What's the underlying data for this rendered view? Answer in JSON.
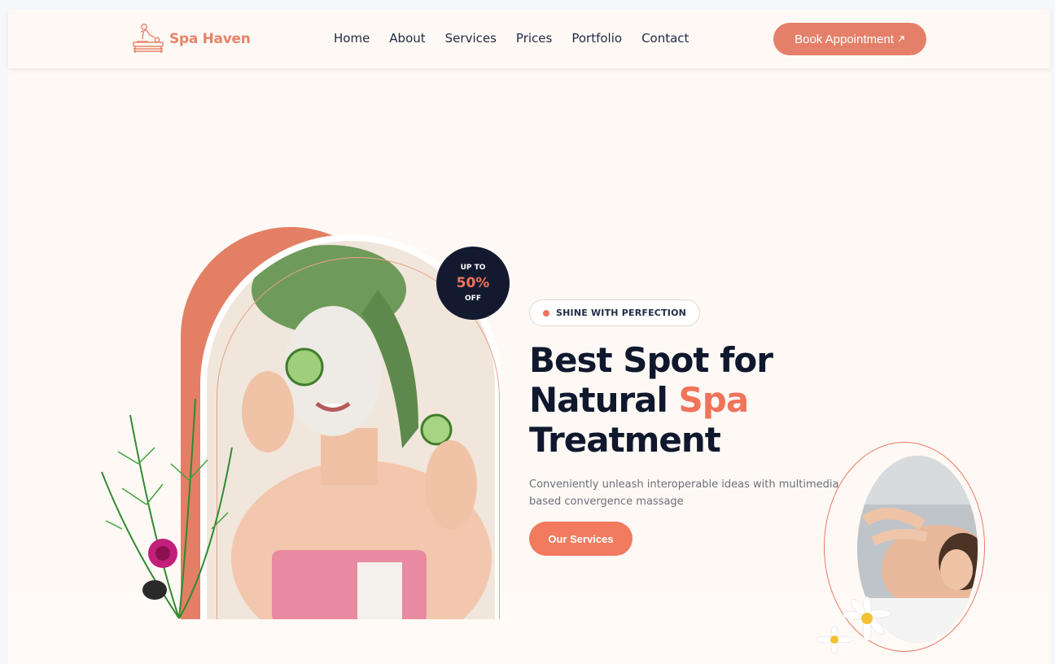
{
  "header": {
    "brand": "Spa Haven",
    "nav": [
      "Home",
      "About",
      "Services",
      "Prices",
      "Portfolio",
      "Contact"
    ],
    "cta_label": "Book Appointment",
    "cta_icon": "arrow-up-right-icon"
  },
  "hero": {
    "badge": {
      "top": "UP TO",
      "value": "50%",
      "bottom": "OFF"
    },
    "tagline": "SHINE WITH PERFECTION",
    "headline_line1": "Best Spot for",
    "headline_line2_pre": "Natural ",
    "headline_line2_accent": "Spa",
    "headline_line3": "Treatment",
    "description": "Conveniently unleash interoperable ideas with multimedia based convergence massage",
    "button_label": "Our Services"
  },
  "colors": {
    "accent": "#f0735a",
    "brand": "#e8846a",
    "dark": "#10182e",
    "background": "#fff9f5"
  }
}
